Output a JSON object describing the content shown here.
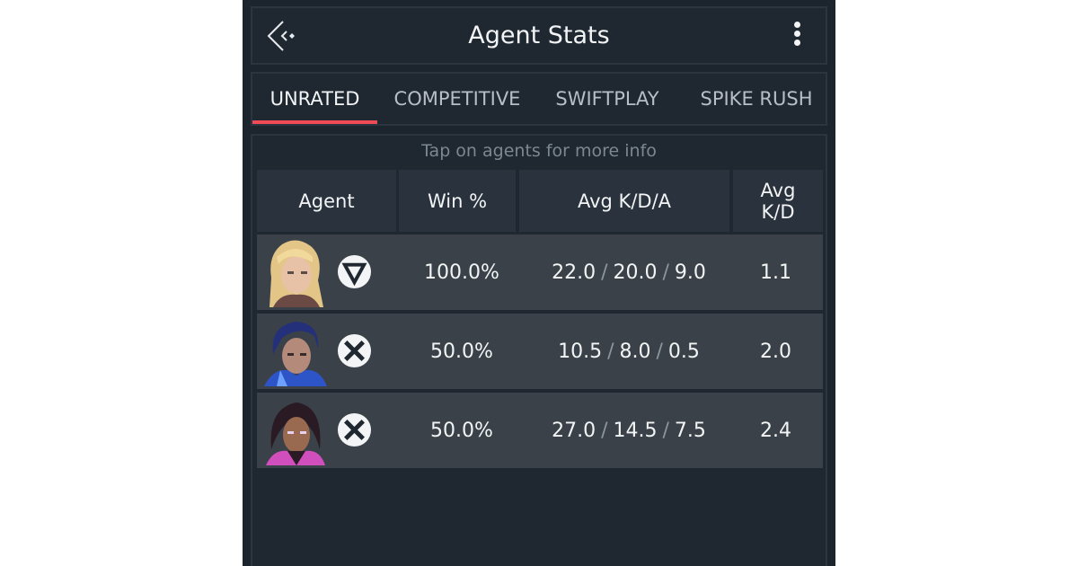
{
  "header": {
    "title": "Agent Stats",
    "back_icon": "back-chevron-icon",
    "menu_icon": "more-vertical-icon"
  },
  "tabs": [
    {
      "label": "UNRATED",
      "active": true
    },
    {
      "label": "COMPETITIVE",
      "active": false
    },
    {
      "label": "SWIFTPLAY",
      "active": false
    },
    {
      "label": "SPIKE RUSH",
      "active": false
    }
  ],
  "accent_color": "#ef4a55",
  "hint": "Tap on agents for more info",
  "table": {
    "columns": [
      "Agent",
      "Win %",
      "Avg K/D/A",
      "Avg K/D"
    ],
    "rows": [
      {
        "result_icon": "win-icon",
        "win": "100.0%",
        "k": "22.0",
        "d": "20.0",
        "a": "9.0",
        "kd": "1.1"
      },
      {
        "result_icon": "loss-icon",
        "win": "50.0%",
        "k": "10.5",
        "d": "8.0",
        "a": "0.5",
        "kd": "2.0"
      },
      {
        "result_icon": "loss-icon",
        "win": "50.0%",
        "k": "27.0",
        "d": "14.5",
        "a": "7.5",
        "kd": "2.4"
      }
    ]
  }
}
